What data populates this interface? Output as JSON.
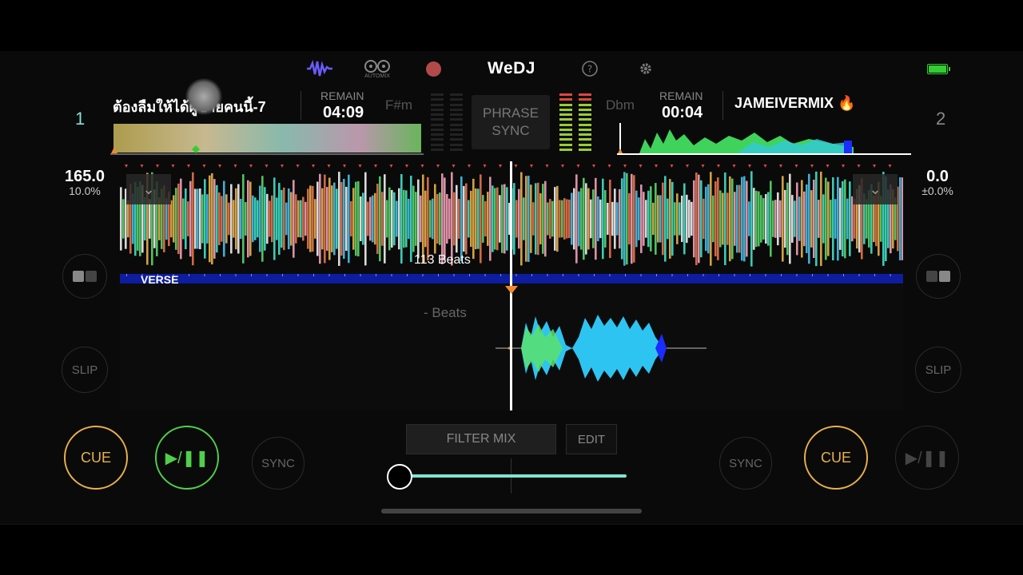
{
  "toolbar": {
    "logo": "WeDJ",
    "automix_label": "AUTOMIX",
    "waveform_icon": "waveform-icon",
    "record_icon": "record-icon",
    "help_icon": "help-icon",
    "settings_icon": "gear-icon",
    "battery_icon": "battery-icon"
  },
  "deck1": {
    "number": "1",
    "title": "ต้องลืมให้ได้ผู้ชายคนนี้-7",
    "remain_label": "REMAIN",
    "remain": "04:09",
    "key": "F#m",
    "bpm": "165.0",
    "pitch": "10.0%",
    "slip": "SLIP",
    "cue": "CUE",
    "play": "▶/❚❚",
    "sync": "SYNC"
  },
  "deck2": {
    "number": "2",
    "title": "JAMEIVERMIX 🔥",
    "remain_label": "REMAIN",
    "remain": "00:04",
    "key": "Dbm",
    "bpm": "0.0",
    "pitch": "±0.0%",
    "slip": "SLIP",
    "cue": "CUE",
    "play": "▶/❚❚",
    "sync": "SYNC"
  },
  "center": {
    "phrase_sync": "PHRASE SYNC",
    "beats_top": "113 Beats",
    "beats_bottom": "- Beats",
    "phrase_label": "VERSE",
    "filter_mix": "FILTER MIX",
    "edit": "EDIT"
  },
  "colors": {
    "cue": "#e8b04a",
    "play": "#4fcf4a",
    "filter": "#7fe4d6",
    "phrase_bar": "#0d1d9e"
  }
}
